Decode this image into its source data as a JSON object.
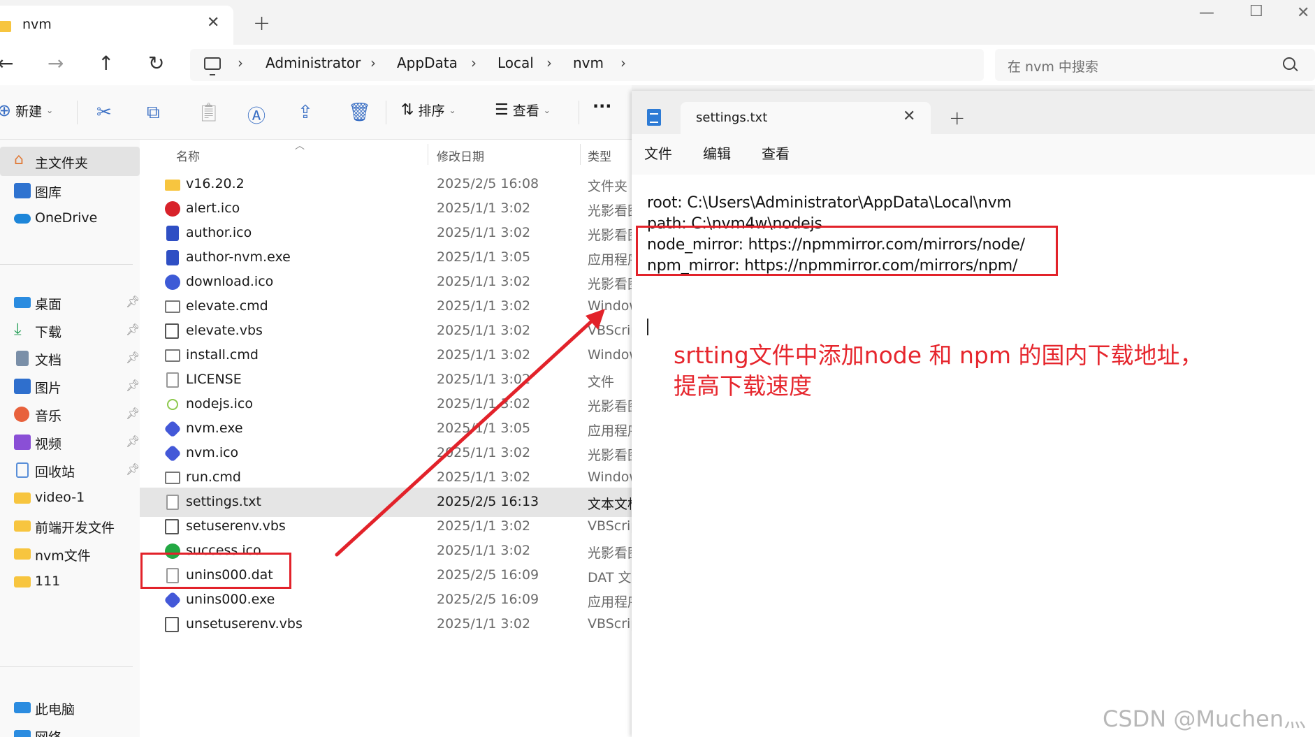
{
  "explorer": {
    "tab_title": "nvm",
    "breadcrumbs": [
      "Administrator",
      "AppData",
      "Local",
      "nvm"
    ],
    "search_placeholder": "在 nvm 中搜索",
    "toolbar": {
      "new_label": "新建",
      "sort_label": "排序",
      "view_label": "查看",
      "more_label": "···"
    },
    "sidebar": {
      "top": [
        {
          "label": "主文件夹",
          "icon": "home-icon"
        },
        {
          "label": "图库",
          "icon": "gallery-icon"
        },
        {
          "label": "OneDrive",
          "icon": "cloud-icon"
        }
      ],
      "pinned": [
        {
          "label": "桌面",
          "icon": "desktop-icon"
        },
        {
          "label": "下载",
          "icon": "download-icon"
        },
        {
          "label": "文档",
          "icon": "document-icon"
        },
        {
          "label": "图片",
          "icon": "picture-icon"
        },
        {
          "label": "音乐",
          "icon": "music-icon"
        },
        {
          "label": "视频",
          "icon": "video-icon"
        },
        {
          "label": "回收站",
          "icon": "recycle-bin-icon"
        }
      ],
      "folders": [
        {
          "label": "video-1"
        },
        {
          "label": "前端开发文件"
        },
        {
          "label": "nvm文件"
        },
        {
          "label": "111"
        }
      ],
      "bottom": [
        {
          "label": "此电脑",
          "icon": "computer-icon"
        },
        {
          "label": "网络",
          "icon": "network-icon"
        }
      ]
    },
    "columns": {
      "name": "名称",
      "date": "修改日期",
      "type": "类型"
    },
    "files": [
      {
        "name": "v16.20.2",
        "date": "2025/2/5 16:08",
        "type": "文件夹",
        "icon": "folder-icon"
      },
      {
        "name": "alert.ico",
        "date": "2025/1/1 3:02",
        "type": "光影看图",
        "icon": "alert-icon"
      },
      {
        "name": "author.ico",
        "date": "2025/1/1 3:02",
        "type": "光影看图",
        "icon": "author-icon"
      },
      {
        "name": "author-nvm.exe",
        "date": "2025/1/1 3:05",
        "type": "应用程序",
        "icon": "author-icon"
      },
      {
        "name": "download.ico",
        "date": "2025/1/1 3:02",
        "type": "光影看图",
        "icon": "download-circle-icon"
      },
      {
        "name": "elevate.cmd",
        "date": "2025/1/1 3:02",
        "type": "Windows",
        "icon": "cmd-icon"
      },
      {
        "name": "elevate.vbs",
        "date": "2025/1/1 3:02",
        "type": "VBScript",
        "icon": "vbs-icon"
      },
      {
        "name": "install.cmd",
        "date": "2025/1/1 3:02",
        "type": "Windows",
        "icon": "cmd-icon"
      },
      {
        "name": "LICENSE",
        "date": "2025/1/1 3:02",
        "type": "文件",
        "icon": "file-icon"
      },
      {
        "name": "nodejs.ico",
        "date": "2025/1/1 3:02",
        "type": "光影看图",
        "icon": "nodejs-icon"
      },
      {
        "name": "nvm.exe",
        "date": "2025/1/1 3:05",
        "type": "应用程序",
        "icon": "nvm-icon"
      },
      {
        "name": "nvm.ico",
        "date": "2025/1/1 3:02",
        "type": "光影看图",
        "icon": "nvm-icon"
      },
      {
        "name": "run.cmd",
        "date": "2025/1/1 3:02",
        "type": "Windows",
        "icon": "cmd-icon"
      },
      {
        "name": "settings.txt",
        "date": "2025/2/5 16:13",
        "type": "文本文档",
        "icon": "text-file-icon",
        "selected": true
      },
      {
        "name": "setuserenv.vbs",
        "date": "2025/1/1 3:02",
        "type": "VBScript",
        "icon": "vbs-icon"
      },
      {
        "name": "success.ico",
        "date": "2025/1/1 3:02",
        "type": "光影看图",
        "icon": "success-icon"
      },
      {
        "name": "unins000.dat",
        "date": "2025/2/5 16:09",
        "type": "DAT 文件",
        "icon": "file-icon"
      },
      {
        "name": "unins000.exe",
        "date": "2025/2/5 16:09",
        "type": "应用程序",
        "icon": "nvm-icon"
      },
      {
        "name": "unsetuserenv.vbs",
        "date": "2025/1/1 3:02",
        "type": "VBScript",
        "icon": "vbs-icon"
      }
    ]
  },
  "notepad": {
    "tab_title": "settings.txt",
    "menu": [
      "文件",
      "编辑",
      "查看"
    ],
    "lines": [
      "root: C:\\Users\\Administrator\\AppData\\Local\\nvm",
      "path: C:\\nvm4w\\nodejs",
      "node_mirror: https://npmmirror.com/mirrors/node/",
      "npm_mirror: https://npmmirror.com/mirrors/npm/"
    ]
  },
  "annotation": {
    "line1": "srtting文件中添加node 和 npm 的国内下载地址，",
    "line2": "提高下载速度",
    "color": "#e6262d"
  },
  "watermark": "CSDN @Muchen灬",
  "colors": {
    "accent_blue": "#3a6fc4",
    "highlight_red": "#e2222a",
    "folder_yellow": "#f7c53f"
  }
}
